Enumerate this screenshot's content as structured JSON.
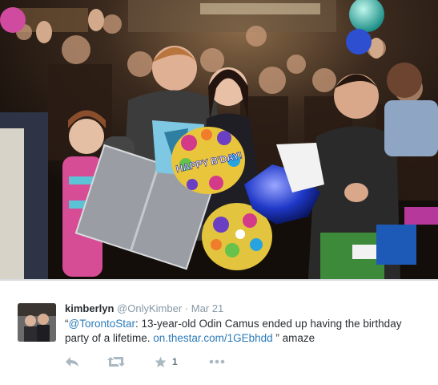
{
  "tweet": {
    "display_name": "kimberlyn",
    "handle": "@OnlyKimber",
    "separator": "·",
    "timestamp": "Mar 21",
    "text_open_quote": "“",
    "mention": "@TorontoStar",
    "body_text": ": 13-year-old Odin Camus ended up having the birthday party of a lifetime. ",
    "link_text": "on.thestar.com/1GEbhdd",
    "close_text": " ” amaze",
    "photo_caption_balloon": "HAPPY B'DAY!",
    "favorite_count": "1"
  },
  "icons": {
    "reply": "reply-icon",
    "retweet": "retweet-icon",
    "favorite": "star-icon",
    "more": "more-dots-icon"
  },
  "colors": {
    "link": "#2b7bb9",
    "name": "#292f33",
    "muted": "#8899a6",
    "icon": "#aab8c2"
  }
}
